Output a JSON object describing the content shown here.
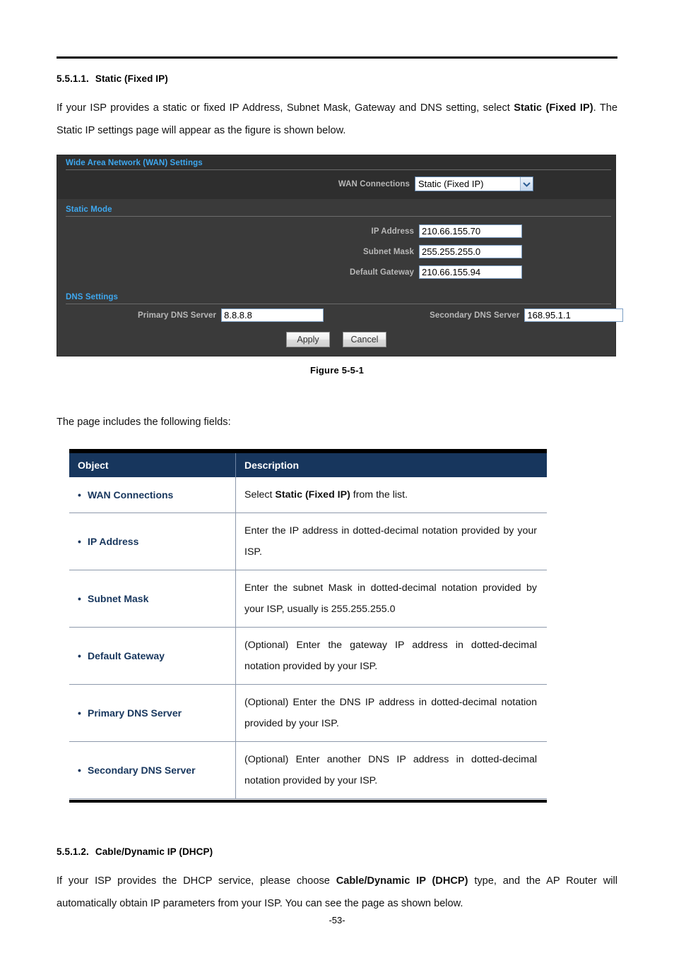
{
  "page": {
    "number": "-53-"
  },
  "sections": [
    {
      "number": "5.5.1.1.",
      "title": "Static (Fixed IP)",
      "paragraph_parts": [
        {
          "text": "If your ISP provides a static or fixed IP Address, Subnet Mask, Gateway and DNS setting, select ",
          "bold": false
        },
        {
          "text": "Static (Fixed IP)",
          "bold": true
        },
        {
          "text": ". The Static IP settings page will appear as the figure is shown below.",
          "bold": false
        }
      ]
    },
    {
      "number": "5.5.1.2.",
      "title": "Cable/Dynamic IP (DHCP)",
      "paragraph_parts": [
        {
          "text": "If your ISP provides the DHCP service, please choose ",
          "bold": false
        },
        {
          "text": "Cable/Dynamic IP (DHCP)",
          "bold": true
        },
        {
          "text": " type, and the AP Router will automatically obtain IP parameters from your ISP. You can see the page as shown below.",
          "bold": false
        }
      ]
    }
  ],
  "router_panel": {
    "wan_section_label": "Wide Area Network (WAN) Settings",
    "wan_connections_label": "WAN Connections",
    "wan_connections_value": "Static (Fixed IP)",
    "wan_connections_options": [
      "Static (Fixed IP)"
    ],
    "static_mode_label": "Static Mode",
    "ip_address_label": "IP Address",
    "ip_address_value": "210.66.155.70",
    "subnet_mask_label": "Subnet Mask",
    "subnet_mask_value": "255.255.255.0",
    "default_gateway_label": "Default Gateway",
    "default_gateway_value": "210.66.155.94",
    "dns_section_label": "DNS Settings",
    "primary_dns_label": "Primary DNS Server",
    "primary_dns_value": "8.8.8.8",
    "secondary_dns_label": "Secondary DNS Server",
    "secondary_dns_value": "168.95.1.1",
    "apply_label": "Apply",
    "cancel_label": "Cancel",
    "colors": {
      "panel_bg": "#333333",
      "panel_body_bg": "#3a3a3a",
      "section_label": "#3ea8f0",
      "field_label": "#b9b9b9"
    }
  },
  "figure": {
    "caption": "Figure 5-5-1"
  },
  "intro_line": "The page includes the following fields:",
  "fields_table": {
    "headers": [
      "Object",
      "Description"
    ],
    "header_bg": "#17365d",
    "rows": [
      {
        "object": "WAN Connections",
        "desc_parts": [
          {
            "text": "Select ",
            "bold": false
          },
          {
            "text": "Static (Fixed IP)",
            "bold": true
          },
          {
            "text": " from the list.",
            "bold": false
          }
        ]
      },
      {
        "object": "IP Address",
        "desc_parts": [
          {
            "text": "Enter the IP address in dotted-decimal notation provided by your ISP.",
            "bold": false
          }
        ]
      },
      {
        "object": "Subnet Mask",
        "desc_parts": [
          {
            "text": "Enter the subnet Mask in dotted-decimal notation provided by your ISP, usually is 255.255.255.0",
            "bold": false
          }
        ]
      },
      {
        "object": "Default Gateway",
        "desc_parts": [
          {
            "text": "(Optional) Enter the gateway IP address in dotted-decimal notation provided by your ISP.",
            "bold": false
          }
        ]
      },
      {
        "object": "Primary DNS Server",
        "desc_parts": [
          {
            "text": "(Optional) Enter the DNS IP address in dotted-decimal notation provided by your ISP.",
            "bold": false
          }
        ]
      },
      {
        "object": "Secondary DNS Server",
        "desc_parts": [
          {
            "text": "(Optional) Enter another DNS IP address in dotted-decimal notation provided by your ISP.",
            "bold": false
          }
        ]
      }
    ]
  }
}
